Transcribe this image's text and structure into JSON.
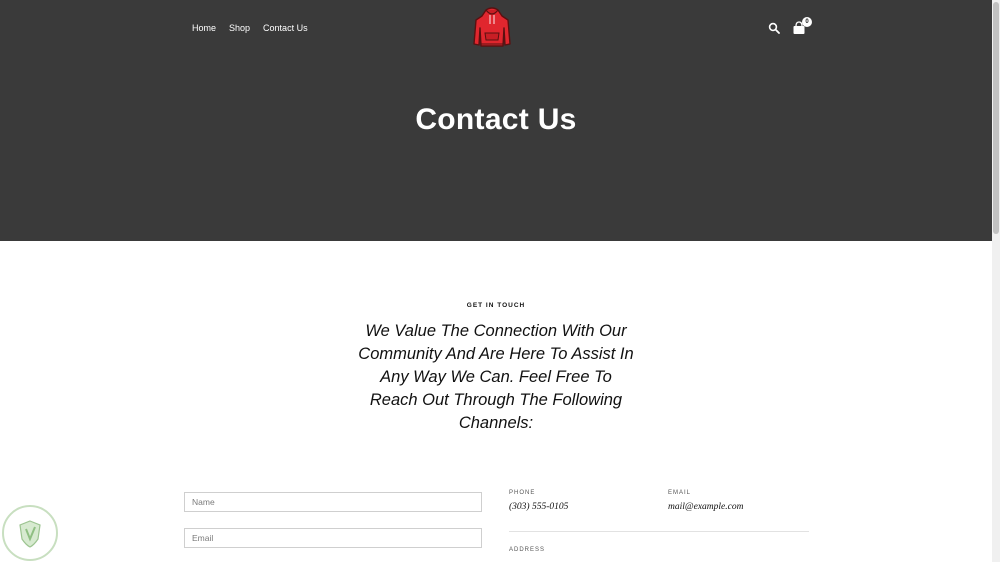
{
  "header": {
    "nav": [
      {
        "label": "Home"
      },
      {
        "label": "Shop"
      },
      {
        "label": "Contact Us"
      }
    ],
    "cart_count": "0",
    "logo_icon": "red-hoodie-icon",
    "search_icon": "search-icon",
    "cart_icon": "shopping-bag-icon"
  },
  "hero": {
    "title": "Contact Us"
  },
  "content": {
    "eyebrow": "GET IN TOUCH",
    "intro": "We Value The Connection With Our Community And Are Here To Assist In Any Way We Can. Feel Free To Reach Out Through The Following Channels:"
  },
  "form": {
    "name_placeholder": "Name",
    "email_placeholder": "Email"
  },
  "contact_info": {
    "phone_label": "PHONE",
    "phone_value": "(303) 555-0105",
    "email_label": "EMAIL",
    "email_value": "mail@example.com",
    "address_label": "ADDRESS"
  },
  "colors": {
    "hero_bg": "#3a3a3a",
    "logo_red": "#e0262e",
    "text": "#111111"
  }
}
